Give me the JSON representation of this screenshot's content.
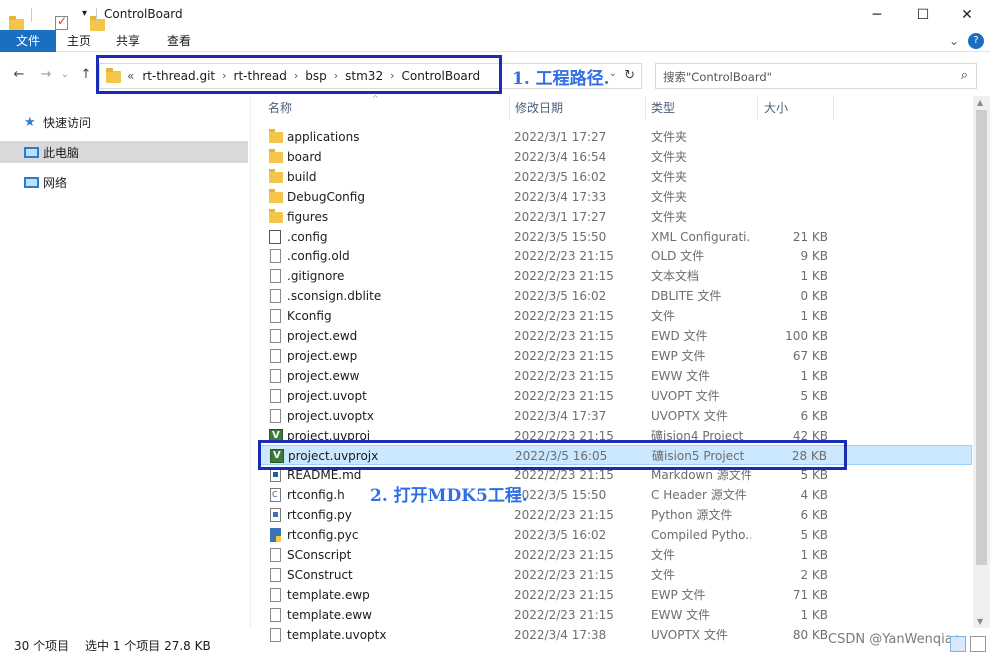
{
  "window": {
    "title": "ControlBoard",
    "minimize": "─",
    "maximize": "☐",
    "close": "✕",
    "help": "?",
    "ribbon_collapse": "⌄"
  },
  "ribbon": {
    "tabs": [
      "文件",
      "主页",
      "共享",
      "查看"
    ]
  },
  "address": {
    "back": "←",
    "forward": "→",
    "recent": "⌄",
    "up": "↑",
    "overflow": "«",
    "breadcrumbs": [
      "rt-thread.git",
      "rt-thread",
      "bsp",
      "stm32",
      "ControlBoard"
    ],
    "separator": "›",
    "refresh": "↻",
    "dropdown": "⌄"
  },
  "search": {
    "placeholder": "搜索\"ControlBoard\"",
    "icon": "⌕"
  },
  "annotations": {
    "step1": "1. 工程路径.",
    "step2": "2. 打开MDK5工程."
  },
  "nav": {
    "items": [
      {
        "label": "快速访问",
        "icon": "star-icon",
        "glyph": "★"
      },
      {
        "label": "此电脑",
        "icon": "computer-icon",
        "glyph": ""
      },
      {
        "label": "网络",
        "icon": "network-icon",
        "glyph": ""
      }
    ]
  },
  "columns": {
    "name": "名称",
    "modified": "修改日期",
    "type": "类型",
    "size": "大小"
  },
  "files": [
    {
      "name": "applications",
      "date": "2022/3/1 17:27",
      "type": "文件夹",
      "size": "",
      "icon": "folder"
    },
    {
      "name": "board",
      "date": "2022/3/4 16:54",
      "type": "文件夹",
      "size": "",
      "icon": "folder"
    },
    {
      "name": "build",
      "date": "2022/3/5 16:02",
      "type": "文件夹",
      "size": "",
      "icon": "folder"
    },
    {
      "name": "DebugConfig",
      "date": "2022/3/4 17:33",
      "type": "文件夹",
      "size": "",
      "icon": "folder"
    },
    {
      "name": "figures",
      "date": "2022/3/1 17:27",
      "type": "文件夹",
      "size": "",
      "icon": "folder"
    },
    {
      "name": ".config",
      "date": "2022/3/5 15:50",
      "type": "XML Configurati...",
      "size": "21 KB",
      "icon": "cfg"
    },
    {
      "name": ".config.old",
      "date": "2022/2/23 21:15",
      "type": "OLD 文件",
      "size": "9 KB",
      "icon": "doc"
    },
    {
      "name": ".gitignore",
      "date": "2022/2/23 21:15",
      "type": "文本文档",
      "size": "1 KB",
      "icon": "doc"
    },
    {
      "name": ".sconsign.dblite",
      "date": "2022/3/5 16:02",
      "type": "DBLITE 文件",
      "size": "0 KB",
      "icon": "doc"
    },
    {
      "name": "Kconfig",
      "date": "2022/2/23 21:15",
      "type": "文件",
      "size": "1 KB",
      "icon": "doc"
    },
    {
      "name": "project.ewd",
      "date": "2022/2/23 21:15",
      "type": "EWD 文件",
      "size": "100 KB",
      "icon": "doc"
    },
    {
      "name": "project.ewp",
      "date": "2022/2/23 21:15",
      "type": "EWP 文件",
      "size": "67 KB",
      "icon": "doc"
    },
    {
      "name": "project.eww",
      "date": "2022/2/23 21:15",
      "type": "EWW 文件",
      "size": "1 KB",
      "icon": "doc"
    },
    {
      "name": "project.uvopt",
      "date": "2022/2/23 21:15",
      "type": "UVOPT 文件",
      "size": "5 KB",
      "icon": "doc"
    },
    {
      "name": "project.uvoptx",
      "date": "2022/3/4 17:37",
      "type": "UVOPTX 文件",
      "size": "6 KB",
      "icon": "doc"
    },
    {
      "name": "project.uvproj",
      "date": "2022/2/23 21:15",
      "type": "礦ision4 Project",
      "size": "42 KB",
      "icon": "uv"
    },
    {
      "name": "project.uvprojx",
      "date": "2022/3/5 16:05",
      "type": "礦ision5 Project",
      "size": "28 KB",
      "icon": "uv",
      "selected": true
    },
    {
      "name": "README.md",
      "date": "2022/2/23 21:15",
      "type": "Markdown 源文件",
      "size": "5 KB",
      "icon": "md"
    },
    {
      "name": "rtconfig.h",
      "date": "2022/3/5 15:50",
      "type": "C Header 源文件",
      "size": "4 KB",
      "icon": "ch"
    },
    {
      "name": "rtconfig.py",
      "date": "2022/2/23 21:15",
      "type": "Python 源文件",
      "size": "6 KB",
      "icon": "py"
    },
    {
      "name": "rtconfig.pyc",
      "date": "2022/3/5 16:02",
      "type": "Compiled Pytho...",
      "size": "5 KB",
      "icon": "pyc"
    },
    {
      "name": "SConscript",
      "date": "2022/2/23 21:15",
      "type": "文件",
      "size": "1 KB",
      "icon": "doc"
    },
    {
      "name": "SConstruct",
      "date": "2022/2/23 21:15",
      "type": "文件",
      "size": "2 KB",
      "icon": "doc"
    },
    {
      "name": "template.ewp",
      "date": "2022/2/23 21:15",
      "type": "EWP 文件",
      "size": "71 KB",
      "icon": "doc"
    },
    {
      "name": "template.eww",
      "date": "2022/2/23 21:15",
      "type": "EWW 文件",
      "size": "1 KB",
      "icon": "doc"
    },
    {
      "name": "template.uvoptx",
      "date": "2022/3/4 17:38",
      "type": "UVOPTX 文件",
      "size": "80 KB",
      "icon": "doc"
    }
  ],
  "status": {
    "count": "30 个项目",
    "selection": "选中 1 个项目  27.8 KB"
  },
  "watermark": "CSDN @YanWenqiao",
  "colors": {
    "accent": "#1a6fc0",
    "annotation": "#1a2bb8",
    "selected_row": "#cce8ff"
  }
}
